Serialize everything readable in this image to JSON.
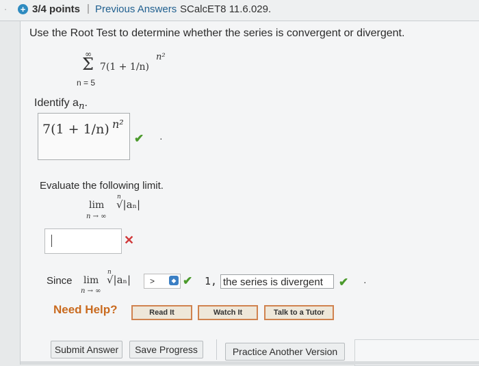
{
  "header": {
    "points": "3/4 points",
    "separator": "|",
    "previous_answers": "Previous Answers",
    "problem_code": "SCalcET8 11.6.029."
  },
  "question": {
    "prompt": "Use the Root Test to determine whether the series is convergent or divergent.",
    "series": {
      "upper": "∞",
      "sigma": "Σ",
      "lower": "n = 5",
      "body": "7(1 + 1/n)",
      "exponent": "n²"
    }
  },
  "part1": {
    "label": "Identify a",
    "label_sub": "n",
    "label_suffix": ".",
    "answer": "7(1 + 1/n)",
    "answer_exponent": "n²",
    "status": "correct",
    "status_mark": "✔",
    "trailing": "·"
  },
  "part2": {
    "label": "Evaluate the following limit.",
    "lim_text": "lim",
    "lim_sub": "n → ∞",
    "root_index": "n",
    "root_expr": "√|aₙ|",
    "input_value": "",
    "status": "incorrect",
    "status_mark": "✕"
  },
  "part3": {
    "since": "Since",
    "lim_text": "lim",
    "lim_sub": "n → ∞",
    "root_index": "n",
    "root_expr": "√|aₙ|",
    "comparison_selected": ">",
    "comparison_check": "✔",
    "value": "1,",
    "conclusion": "the series is divergent",
    "conclusion_check": "✔",
    "trailing": "·"
  },
  "help": {
    "label": "Need Help?",
    "read": "Read It",
    "watch": "Watch It",
    "tutor": "Talk to a Tutor"
  },
  "actions": {
    "submit": "Submit Answer",
    "save": "Save Progress",
    "practice": "Practice Another Version"
  },
  "colors": {
    "correct": "#4b9a2c",
    "incorrect": "#d0393a",
    "link": "#1f5f8f",
    "help_accent": "#c96a1e"
  }
}
